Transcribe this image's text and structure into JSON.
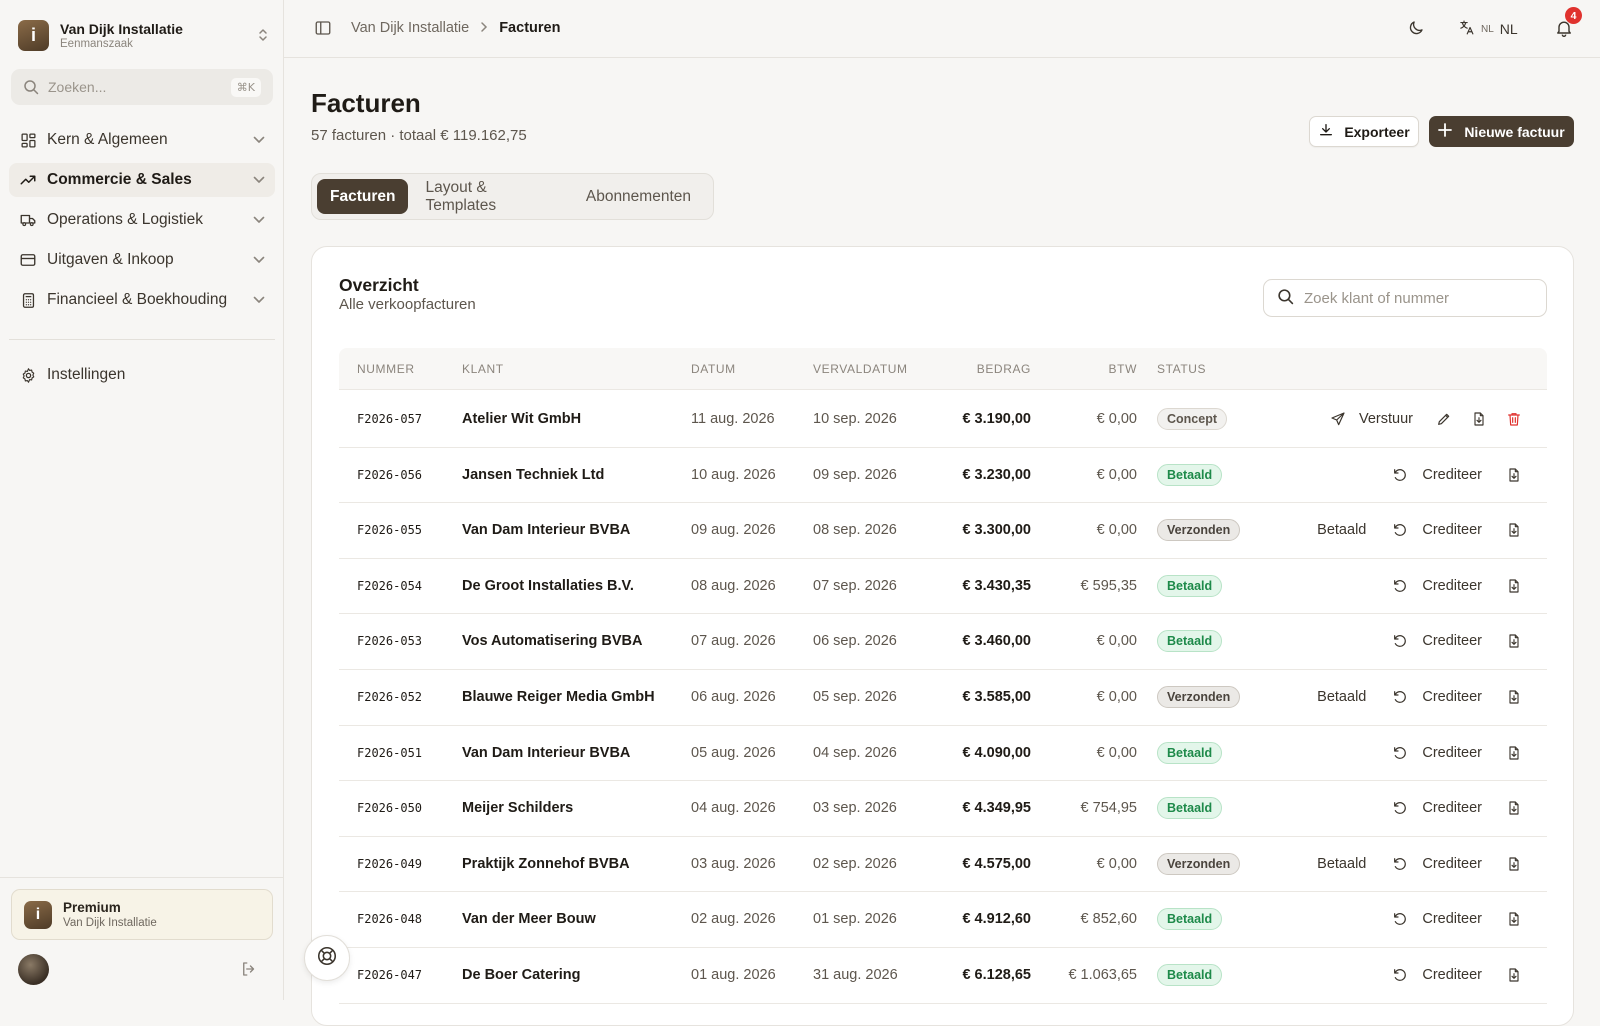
{
  "org": {
    "initial": "i",
    "name": "Van Dijk Installatie",
    "type": "Eenmanszaak"
  },
  "search": {
    "placeholder": "Zoeken...",
    "shortcut": "⌘K"
  },
  "nav": [
    {
      "label": "Kern & Algemeen",
      "icon": "grid-icon",
      "active": false
    },
    {
      "label": "Commercie & Sales",
      "icon": "trending-up-icon",
      "active": true
    },
    {
      "label": "Operations & Logistiek",
      "icon": "truck-icon",
      "active": false
    },
    {
      "label": "Uitgaven & Inkoop",
      "icon": "credit-card-icon",
      "active": false
    },
    {
      "label": "Financieel & Boekhouding",
      "icon": "calculator-icon",
      "active": false
    }
  ],
  "settings": {
    "label": "Instellingen"
  },
  "premium": {
    "title": "Premium",
    "subtitle": "Van Dijk Installatie"
  },
  "breadcrumb": {
    "parent": "Van Dijk Installatie",
    "current": "Facturen"
  },
  "header": {
    "lang_small": "NL",
    "lang": "NL",
    "notifications": "4"
  },
  "page": {
    "title": "Facturen",
    "subtitle": "57 facturen · totaal € 119.162,75",
    "export_label": "Exporteer",
    "new_label": "Nieuwe factuur"
  },
  "tabs": [
    "Facturen",
    "Layout & Templates",
    "Abonnementen"
  ],
  "overview": {
    "title": "Overzicht",
    "subtitle": "Alle verkoopfacturen",
    "search_placeholder": "Zoek klant of nummer"
  },
  "columns": [
    "NUMMER",
    "KLANT",
    "DATUM",
    "VERVALDATUM",
    "BEDRAG",
    "BTW",
    "STATUS"
  ],
  "action_labels": {
    "send": "Verstuur",
    "paid": "Betaald",
    "credit": "Crediteer"
  },
  "colors": {
    "accent": "#4a3e31",
    "paid": "#1e8a4a",
    "danger": "#e0322e"
  },
  "invoices": [
    {
      "number": "F2026-057",
      "client": "Atelier Wit GmbH",
      "date": "11 aug. 2026",
      "due": "10 sep. 2026",
      "amount": "€ 3.190,00",
      "vat": "€ 0,00",
      "status": "Concept"
    },
    {
      "number": "F2026-056",
      "client": "Jansen Techniek Ltd",
      "date": "10 aug. 2026",
      "due": "09 sep. 2026",
      "amount": "€ 3.230,00",
      "vat": "€ 0,00",
      "status": "Betaald"
    },
    {
      "number": "F2026-055",
      "client": "Van Dam Interieur BVBA",
      "date": "09 aug. 2026",
      "due": "08 sep. 2026",
      "amount": "€ 3.300,00",
      "vat": "€ 0,00",
      "status": "Verzonden"
    },
    {
      "number": "F2026-054",
      "client": "De Groot Installaties B.V.",
      "date": "08 aug. 2026",
      "due": "07 sep. 2026",
      "amount": "€ 3.430,35",
      "vat": "€ 595,35",
      "status": "Betaald"
    },
    {
      "number": "F2026-053",
      "client": "Vos Automatisering BVBA",
      "date": "07 aug. 2026",
      "due": "06 sep. 2026",
      "amount": "€ 3.460,00",
      "vat": "€ 0,00",
      "status": "Betaald"
    },
    {
      "number": "F2026-052",
      "client": "Blauwe Reiger Media GmbH",
      "date": "06 aug. 2026",
      "due": "05 sep. 2026",
      "amount": "€ 3.585,00",
      "vat": "€ 0,00",
      "status": "Verzonden"
    },
    {
      "number": "F2026-051",
      "client": "Van Dam Interieur BVBA",
      "date": "05 aug. 2026",
      "due": "04 sep. 2026",
      "amount": "€ 4.090,00",
      "vat": "€ 0,00",
      "status": "Betaald"
    },
    {
      "number": "F2026-050",
      "client": "Meijer Schilders",
      "date": "04 aug. 2026",
      "due": "03 sep. 2026",
      "amount": "€ 4.349,95",
      "vat": "€ 754,95",
      "status": "Betaald"
    },
    {
      "number": "F2026-049",
      "client": "Praktijk Zonnehof BVBA",
      "date": "03 aug. 2026",
      "due": "02 sep. 2026",
      "amount": "€ 4.575,00",
      "vat": "€ 0,00",
      "status": "Verzonden"
    },
    {
      "number": "F2026-048",
      "client": "Van der Meer Bouw",
      "date": "02 aug. 2026",
      "due": "01 sep. 2026",
      "amount": "€ 4.912,60",
      "vat": "€ 852,60",
      "status": "Betaald"
    },
    {
      "number": "F2026-047",
      "client": "De Boer Catering",
      "date": "01 aug. 2026",
      "due": "31 aug. 2026",
      "amount": "€ 6.128,65",
      "vat": "€ 1.063,65",
      "status": "Betaald"
    }
  ]
}
